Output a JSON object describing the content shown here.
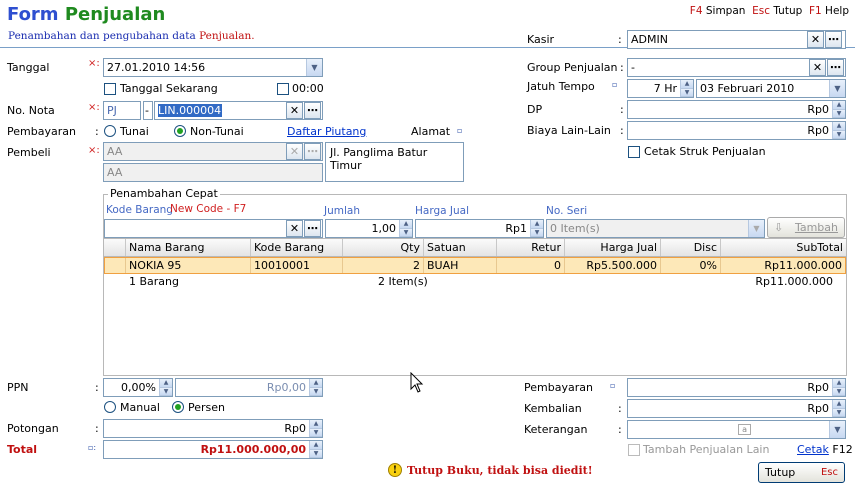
{
  "header": {
    "title_part1": "Form",
    "title_part2": "Penjualan",
    "subtitle_part1": "Penambahan dan pengubahan data",
    "subtitle_part2": "Penjualan.",
    "shortcuts": [
      {
        "key": "F4",
        "label": "Simpan"
      },
      {
        "key": "Esc",
        "label": "Tutup"
      },
      {
        "key": "F1",
        "label": "Help"
      }
    ]
  },
  "kasir": {
    "label": "Kasir",
    "value": "ADMIN"
  },
  "tanggal": {
    "label": "Tanggal",
    "value": "27.01.2010 14:56",
    "tanggal_sekarang": "Tanggal Sekarang",
    "time_check": "00:00"
  },
  "nota": {
    "label": "No. Nota",
    "prefix": "PJ",
    "sep": "-",
    "value": "LIN.000004"
  },
  "pembayaran_top": {
    "label": "Pembayaran",
    "opt_tunai": "Tunai",
    "opt_nontunai": "Non-Tunai",
    "link": "Daftar Piutang",
    "alamat_label": "Alamat"
  },
  "pembeli": {
    "label": "Pembeli",
    "value": "AA",
    "value2": "AA",
    "alamat": "Jl. Panglima Batur Timur"
  },
  "group": {
    "label": "Group Penjualan",
    "value": "-"
  },
  "jatuh_tempo": {
    "label": "Jatuh Tempo",
    "days": "7 Hr",
    "date": "03 Februari 2010"
  },
  "dp": {
    "label": "DP",
    "value": "Rp0"
  },
  "biaya": {
    "label": "Biaya Lain-Lain",
    "value": "Rp0"
  },
  "cetak_struk": "Cetak Struk Penjualan",
  "quick": {
    "title": "Penambahan Cepat",
    "kode_label": "Kode Barang",
    "new_code": "New Code - F7",
    "jumlah_label": "Jumlah",
    "jumlah_value": "1,00",
    "harga_label": "Harga Jual",
    "harga_value": "Rp1",
    "seri_label": "No. Seri",
    "seri_value": "0 Item(s)",
    "tambah": "Tambah"
  },
  "table": {
    "columns": [
      "",
      "Nama Barang",
      "Kode Barang",
      "Qty",
      "Satuan",
      "Retur",
      "Harga Jual",
      "Disc",
      "SubTotal"
    ],
    "rows": [
      {
        "nama": "NOKIA 95",
        "kode": "10010001",
        "qty": "2",
        "satuan": "BUAH",
        "retur": "0",
        "harga": "Rp5.500.000",
        "disc": "0%",
        "subtotal": "Rp11.000.000"
      }
    ],
    "footer": {
      "count": "1 Barang",
      "items": "2 Item(s)",
      "total": "Rp11.000.000"
    }
  },
  "ppn": {
    "label": "PPN",
    "percent": "0,00%",
    "amount": "Rp0,00",
    "opt_manual": "Manual",
    "opt_persen": "Persen"
  },
  "potongan": {
    "label": "Potongan",
    "value": "Rp0"
  },
  "total": {
    "label": "Total",
    "value": "Rp11.000.000,00"
  },
  "pembayaran_bottom": {
    "label": "Pembayaran",
    "value": "Rp0"
  },
  "kembalian": {
    "label": "Kembalian",
    "value": "Rp0"
  },
  "keterangan": {
    "label": "Keterangan",
    "value": ""
  },
  "tambah_penjualan_lain": "Tambah Penjualan Lain",
  "cetak": {
    "link": "Cetak",
    "key": "F12"
  },
  "warning": "Tutup Buku, tidak bisa diedit!",
  "tutup_btn": {
    "label": "Tutup",
    "key": "Esc"
  }
}
